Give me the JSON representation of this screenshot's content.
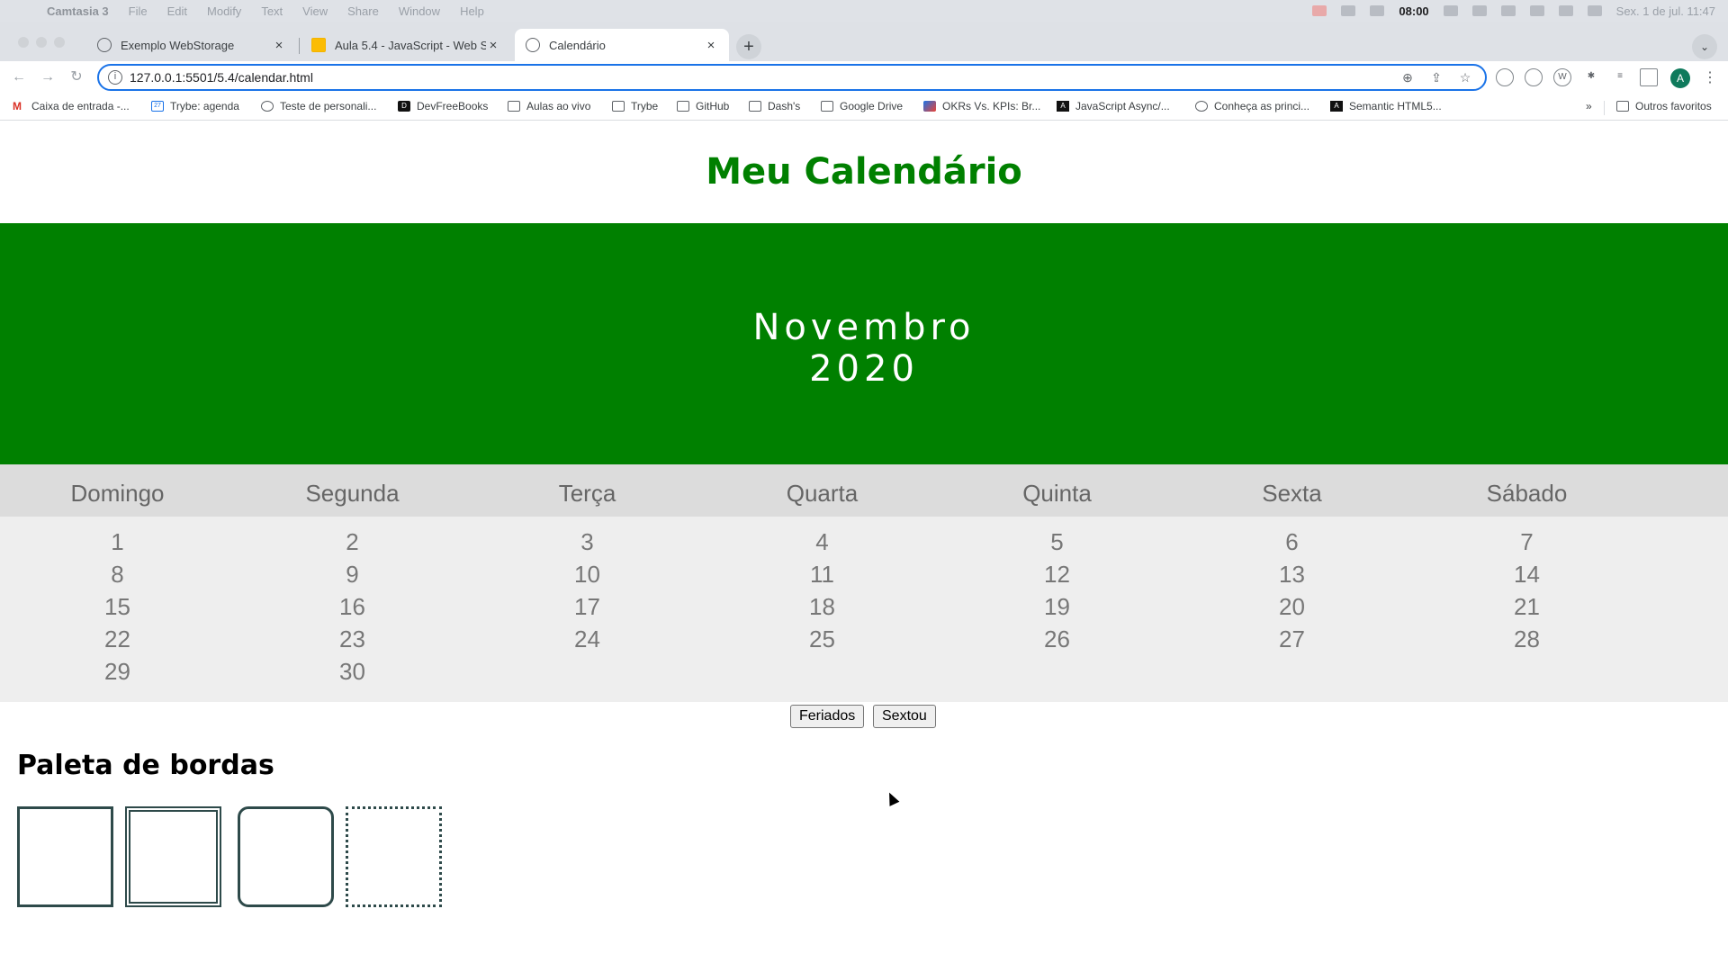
{
  "menubar": {
    "app": "Camtasia 3",
    "items": [
      "File",
      "Edit",
      "Modify",
      "Text",
      "View",
      "Share",
      "Window",
      "Help"
    ],
    "clock": "08:00",
    "datetime": "Sex. 1 de jul.  11:47"
  },
  "tabs": [
    {
      "label": "Exemplo WebStorage",
      "close": "×"
    },
    {
      "label": "Aula 5.4 - JavaScript - Web St",
      "close": "×"
    },
    {
      "label": "Calendário",
      "close": "×"
    }
  ],
  "toolbar": {
    "new_tab": "+",
    "tab_search": "⌄",
    "back": "←",
    "forward": "→",
    "reload": "↻",
    "url": "127.0.0.1:5501/5.4/calendar.html",
    "avatar": "A"
  },
  "bookmarks": {
    "items": [
      {
        "label": "Caixa de entrada -...",
        "icon": "gmail-icon"
      },
      {
        "label": "Trybe: agenda",
        "icon": "calendar-icon"
      },
      {
        "label": "Teste de personali...",
        "icon": "site-icon"
      },
      {
        "label": "DevFreeBooks",
        "icon": "devfreebooks-icon"
      },
      {
        "label": "Aulas ao vivo",
        "icon": "folder-icon"
      },
      {
        "label": "Trybe",
        "icon": "folder-icon"
      },
      {
        "label": "GitHub",
        "icon": "folder-icon"
      },
      {
        "label": "Dash's",
        "icon": "folder-icon"
      },
      {
        "label": "Google Drive",
        "icon": "folder-icon"
      },
      {
        "label": "OKRs Vs. KPIs: Br...",
        "icon": "okr-icon"
      },
      {
        "label": "JavaScript Async/...",
        "icon": "js-icon"
      },
      {
        "label": "Conheça as princi...",
        "icon": "site-icon"
      },
      {
        "label": "Semantic HTML5...",
        "icon": "js-icon"
      }
    ],
    "more": "»",
    "other": "Outros favoritos"
  },
  "page": {
    "title": "Meu Calendário",
    "month": "Novembro",
    "year": "2020",
    "weekdays": [
      "Domingo",
      "Segunda",
      "Terça",
      "Quarta",
      "Quinta",
      "Sexta",
      "Sábado"
    ],
    "days": [
      "1",
      "2",
      "3",
      "4",
      "5",
      "6",
      "7",
      "8",
      "9",
      "10",
      "11",
      "12",
      "13",
      "14",
      "15",
      "16",
      "17",
      "18",
      "19",
      "20",
      "21",
      "22",
      "23",
      "24",
      "25",
      "26",
      "27",
      "28",
      "29",
      "30"
    ],
    "holidays_button": "Feriados",
    "friday_button": "Sextou",
    "palette_title": "Paleta de bordas",
    "palette_swatches": [
      "solid-border",
      "double-border",
      "rounded-border",
      "dotted-border"
    ]
  }
}
